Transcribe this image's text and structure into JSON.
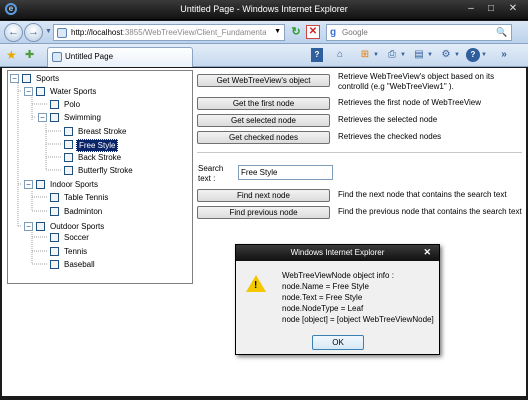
{
  "window": {
    "title": "Untitled Page - Windows Internet Explorer",
    "minimize": "–",
    "maximize": "□",
    "close": "✕"
  },
  "navigation": {
    "back": "←",
    "forward": "→",
    "address_host": "http://localhost",
    "address_path": ":3855/WebTreeView/Client_Fundamenta",
    "search_placeholder": "Google"
  },
  "tab": {
    "label": "Untitled Page"
  },
  "tree": {
    "nodes": [
      {
        "label": "Sports",
        "level": 0,
        "expanded": true
      },
      {
        "label": "Water Sports",
        "level": 1,
        "expanded": true
      },
      {
        "label": "Polo",
        "level": 2
      },
      {
        "label": "Swimming",
        "level": 2,
        "expanded": true
      },
      {
        "label": "Breast Stroke",
        "level": 3
      },
      {
        "label": "Free Style",
        "level": 3,
        "selected": true
      },
      {
        "label": "Back Stroke",
        "level": 3
      },
      {
        "label": "Butterfly Stroke",
        "level": 3
      },
      {
        "label": "Indoor Sports",
        "level": 1,
        "expanded": true
      },
      {
        "label": "Table Tennis",
        "level": 2
      },
      {
        "label": "Badminton",
        "level": 2
      },
      {
        "label": "Outdoor Sports",
        "level": 1,
        "expanded": true
      },
      {
        "label": "Soccer",
        "level": 2
      },
      {
        "label": "Tennis",
        "level": 2
      },
      {
        "label": "Baseball",
        "level": 2
      }
    ]
  },
  "actions": [
    {
      "label": "Get WebTreeView's object",
      "desc1": "Retrieve WebTreeView's object based on its",
      "desc2": "controlId (e.g \"WebTreeView1\" )."
    },
    {
      "label": "Get the first node",
      "desc1": "Retrieves the first node of WebTreeView",
      "desc2": ""
    },
    {
      "label": "Get selected node",
      "desc1": "Retrieves the selected node",
      "desc2": ""
    },
    {
      "label": "Get checked nodes",
      "desc1": "Retrieves the checked nodes",
      "desc2": ""
    }
  ],
  "search": {
    "label": "Search text :",
    "value": "Free Style",
    "find_next_label": "Find next node",
    "find_next_desc": "Find the next node that contains the search text",
    "find_prev_label": "Find previous node",
    "find_prev_desc": "Find the previous node that contains the search text"
  },
  "dialog": {
    "title": "Windows Internet Explorer",
    "lines": [
      "WebTreeViewNode object info :",
      "node.Name = Free Style",
      "node.Text = Free Style",
      "node.NodeType = Leaf",
      "node [object] = [object WebTreeViewNode]"
    ],
    "ok_label": "OK"
  }
}
